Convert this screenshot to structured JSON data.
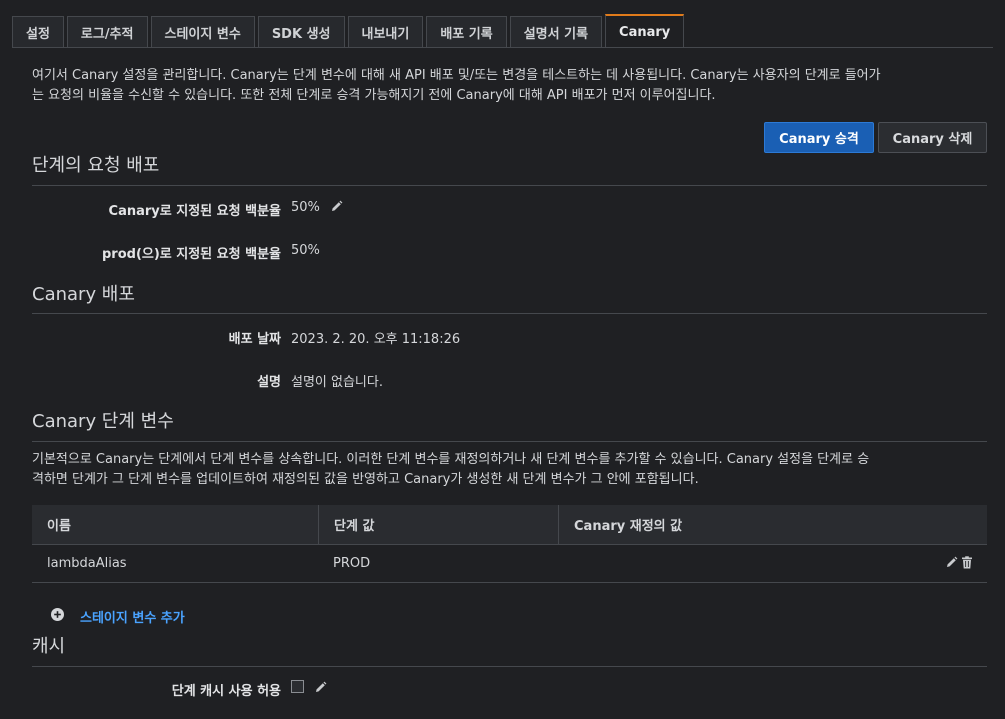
{
  "tabs": [
    {
      "label": "설정",
      "active": false
    },
    {
      "label": "로그/추적",
      "active": false
    },
    {
      "label": "스테이지 변수",
      "active": false
    },
    {
      "label": "SDK 생성",
      "active": false
    },
    {
      "label": "내보내기",
      "active": false
    },
    {
      "label": "배포 기록",
      "active": false
    },
    {
      "label": "설명서 기록",
      "active": false
    },
    {
      "label": "Canary",
      "active": true
    }
  ],
  "intro": {
    "line1": "여기서 Canary 설정을 관리합니다. Canary는 단계 변수에 대해 새 API 배포 및/또는 변경을 테스트하는 데 사용됩니다. Canary는 사용자의 단계로 들어가",
    "line2": "는 요청의 비율을 수신할 수 있습니다. 또한 전체 단계로 승격 가능해지기 전에 Canary에 대해 API 배포가 먼저 이루어집니다."
  },
  "buttons": {
    "promote": "Canary 승격",
    "delete": "Canary 삭제"
  },
  "request_distribution": {
    "title": "단계의 요청 배포",
    "canary_label": "Canary로 지정된 요청 백분율",
    "canary_value": "50%",
    "prod_label": "prod(으)로 지정된 요청 백분율",
    "prod_value": "50%"
  },
  "deployment": {
    "title": "Canary 배포",
    "date_label": "배포 날짜",
    "date_value": "2023. 2. 20. 오후 11:18:26",
    "desc_label": "설명",
    "desc_value": "설명이 없습니다."
  },
  "stage_vars": {
    "title": "Canary 단계 변수",
    "desc_line1": "기본적으로 Canary는 단계에서 단계 변수를 상속합니다. 이러한 단계 변수를 재정의하거나 새 단계 변수를 추가할 수 있습니다. Canary 설정을 단계로 승",
    "desc_line2": "격하면 단계가 그 단계 변수를 업데이트하여 재정의된 값을 반영하고 Canary가 생성한 새 단계 변수가 그 안에 포함됩니다.",
    "columns": [
      "이름",
      "단계 값",
      "Canary 재정의 값"
    ],
    "rows": [
      {
        "name": "lambdaAlias",
        "stage_value": "PROD",
        "override": ""
      }
    ],
    "add_label": "스테이지 변수 추가"
  },
  "cache": {
    "title": "캐시",
    "enable_label": "단계 캐시 사용 허용",
    "enabled": false
  },
  "colors": {
    "accent_tab": "#e07b1b",
    "primary_button": "#1a5fb4",
    "link": "#4aa3ff"
  }
}
